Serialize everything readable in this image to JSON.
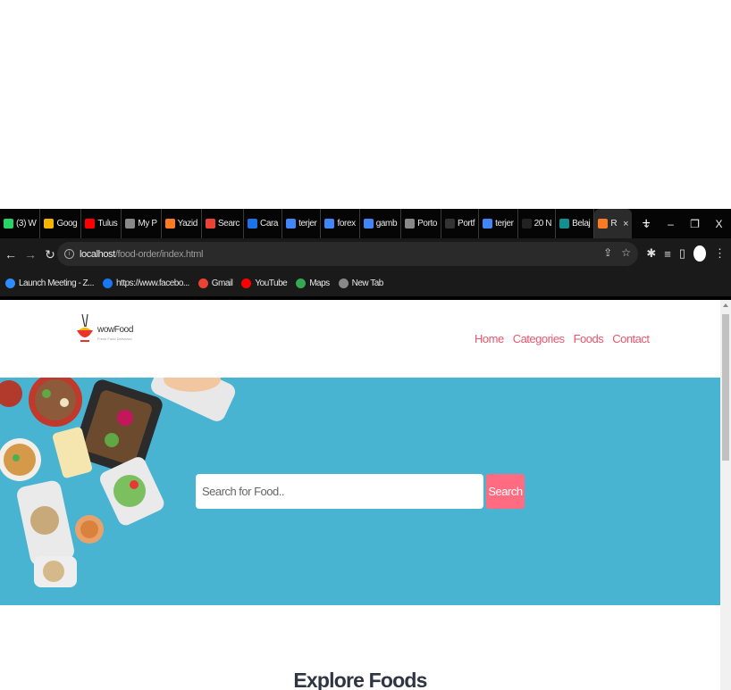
{
  "browser": {
    "tabs": [
      {
        "label": "(3) W",
        "icon": "whatsapp-icon",
        "color": "#25d366"
      },
      {
        "label": "Goog",
        "icon": "google-drive-icon",
        "color": "#f4b400"
      },
      {
        "label": "Tulus",
        "icon": "youtube-icon",
        "color": "#ff0000"
      },
      {
        "label": "My P",
        "icon": "globe-icon",
        "color": "#888888"
      },
      {
        "label": "Yazid",
        "icon": "xampp-icon",
        "color": "#fb7a24"
      },
      {
        "label": "Searc",
        "icon": "gmail-icon",
        "color": "#ea4335"
      },
      {
        "label": "Cara",
        "icon": "app-icon",
        "color": "#1a73e8"
      },
      {
        "label": "terjer",
        "icon": "google-icon",
        "color": "#4285f4"
      },
      {
        "label": "forex",
        "icon": "google-icon",
        "color": "#4285f4"
      },
      {
        "label": "gamb",
        "icon": "google-icon",
        "color": "#4285f4"
      },
      {
        "label": "Porto",
        "icon": "star-icon",
        "color": "#888888"
      },
      {
        "label": "Portf",
        "icon": "page-icon",
        "color": "#333333"
      },
      {
        "label": "terjer",
        "icon": "google-icon",
        "color": "#4285f4"
      },
      {
        "label": "20 N",
        "icon": "page-icon",
        "color": "#222222"
      },
      {
        "label": "Belaj",
        "icon": "app-icon",
        "color": "#138f8f"
      },
      {
        "label": "R",
        "icon": "xampp-icon",
        "color": "#fb7a24",
        "active": true
      }
    ],
    "new_tab": "+",
    "window_controls": {
      "dropdown": "⌄",
      "minimize": "–",
      "restore": "❐",
      "close": "X"
    },
    "url": {
      "host": "localhost",
      "path": "/food-order/index.html"
    },
    "bookmarks": [
      {
        "label": "Launch Meeting - Z...",
        "icon": "zoom-icon",
        "color": "#2d8cff"
      },
      {
        "label": "https://www.facebo...",
        "icon": "facebook-icon",
        "color": "#1877f2"
      },
      {
        "label": "Gmail",
        "icon": "gmail-icon",
        "color": "#ea4335"
      },
      {
        "label": "YouTube",
        "icon": "youtube-icon",
        "color": "#ff0000"
      },
      {
        "label": "Maps",
        "icon": "maps-icon",
        "color": "#34a853"
      },
      {
        "label": "New Tab",
        "icon": "globe-icon",
        "color": "#888888"
      }
    ]
  },
  "site": {
    "logo": {
      "name": "wowFood",
      "tagline": "Fresh Food Delivered"
    },
    "menu": [
      "Home",
      "Categories",
      "Foods",
      "Contact"
    ],
    "search": {
      "placeholder": "Search for Food..",
      "button": "Search"
    },
    "section_title": "Explore Foods",
    "colors": {
      "accent": "#ff6b81",
      "hero_bg": "#49b3d2",
      "menu": "#e8566c"
    }
  }
}
